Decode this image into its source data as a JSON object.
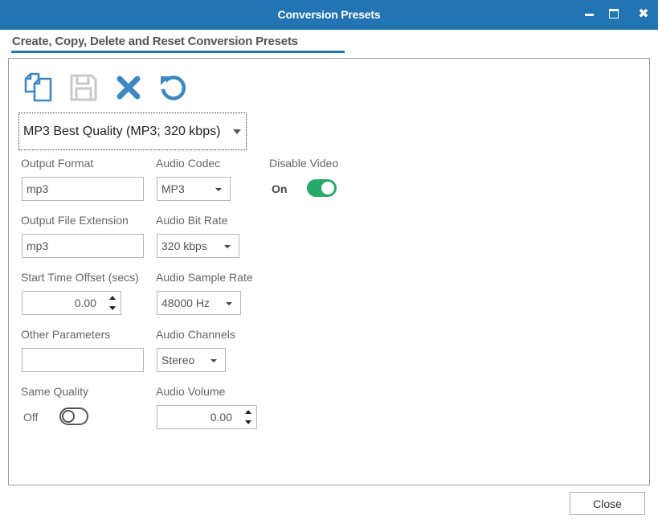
{
  "window": {
    "title": "Conversion Presets",
    "controls": {
      "minimize": "minimize-icon",
      "maximize": "maximize-icon",
      "close": "close-icon"
    }
  },
  "section": {
    "title": "Create, Copy, Delete and Reset Conversion Presets"
  },
  "toolbar": {
    "buttons": [
      {
        "name": "copy-preset",
        "icon": "copy-icon",
        "color": "#3e88c0",
        "enabled": true
      },
      {
        "name": "save-preset",
        "icon": "save-icon",
        "color": "#c8c8c8",
        "enabled": false
      },
      {
        "name": "delete-preset",
        "icon": "delete-x-icon",
        "color": "#3e88c0",
        "enabled": true
      },
      {
        "name": "reset-preset",
        "icon": "reset-icon",
        "color": "#3e88c0",
        "enabled": true
      }
    ]
  },
  "preset": {
    "selected": "MP3 Best Quality (MP3; 320 kbps)"
  },
  "fields": {
    "output_format": {
      "label": "Output Format",
      "value": "mp3"
    },
    "output_file_extension": {
      "label": "Output File Extension",
      "value": "mp3"
    },
    "start_time_offset": {
      "label": "Start Time Offset (secs)",
      "value": "0.00"
    },
    "other_parameters": {
      "label": "Other Parameters",
      "value": ""
    },
    "same_quality": {
      "label": "Same Quality",
      "state": "Off"
    },
    "audio_codec": {
      "label": "Audio Codec",
      "value": "MP3"
    },
    "audio_bit_rate": {
      "label": "Audio Bit Rate",
      "value": "320 kbps"
    },
    "audio_sample_rate": {
      "label": "Audio Sample Rate",
      "value": "48000 Hz"
    },
    "audio_channels": {
      "label": "Audio Channels",
      "value": "Stereo"
    },
    "audio_volume": {
      "label": "Audio Volume",
      "value": "0.00"
    },
    "disable_video": {
      "label": "Disable Video",
      "state": "On"
    }
  },
  "colors": {
    "accent": "#2374b3",
    "toggle_on": "#26a96b"
  },
  "footer": {
    "close_label": "Close"
  }
}
